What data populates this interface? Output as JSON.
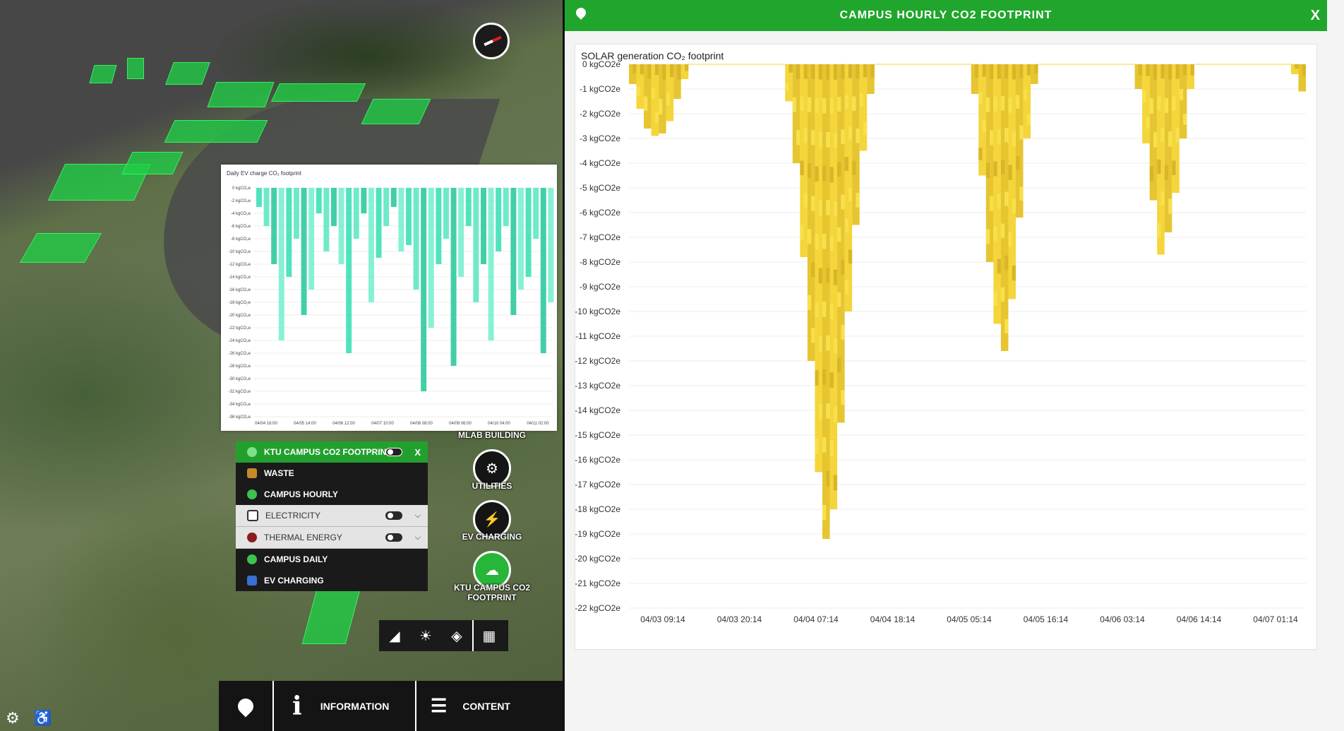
{
  "panel": {
    "header_title": "CAMPUS HOURLY CO2 FOOTPRINT",
    "close_label": "X",
    "chart_title": "SOLAR generation CO₂ footprint"
  },
  "mini_chart_title": "Daily EV charge CO₂ footprint",
  "layers": {
    "header": {
      "label": "KTU CAMPUS CO2 FOOTPRINT",
      "close": "X"
    },
    "items": [
      {
        "label": "WASTE",
        "style": "dark",
        "toggle": false
      },
      {
        "label": "CAMPUS HOURLY",
        "style": "dark",
        "toggle": false
      },
      {
        "label": "ELECTRICITY",
        "style": "light",
        "toggle": true
      },
      {
        "label": "THERMAL ENERGY",
        "style": "light",
        "toggle": true
      },
      {
        "label": "CAMPUS DAILY",
        "style": "dark",
        "toggle": false
      },
      {
        "label": "EV CHARGING",
        "style": "dark",
        "toggle": false
      }
    ]
  },
  "poi": {
    "mlab": "MLAB BUILDING",
    "utilities": "UTILITIES",
    "ev": "EV CHARGING",
    "ktu_line1": "KTU CAMPUS CO2",
    "ktu_line2": "FOOTPRINT"
  },
  "bottombar": {
    "information": "INFORMATION",
    "content": "CONTENT"
  },
  "colors": {
    "accent": "#20a62c",
    "solar": "#f4d53a",
    "solar_dark": "#d9b528",
    "ev": "#3ee0b6"
  },
  "chart_data": [
    {
      "type": "bar",
      "title": "SOLAR generation CO₂ footprint",
      "ylabel": "",
      "ylim": [
        -22,
        0
      ],
      "yticks": [
        "0 kgCO2e",
        "-1 kgCO2e",
        "-2 kgCO2e",
        "-3 kgCO2e",
        "-4 kgCO2e",
        "-5 kgCO2e",
        "-6 kgCO2e",
        "-7 kgCO2e",
        "-8 kgCO2e",
        "-9 kgCO2e",
        "-10 kgCO2e",
        "-11 kgCO2e",
        "-12 kgCO2e",
        "-13 kgCO2e",
        "-14 kgCO2e",
        "-15 kgCO2e",
        "-16 kgCO2e",
        "-17 kgCO2e",
        "-18 kgCO2e",
        "-19 kgCO2e",
        "-20 kgCO2e",
        "-21 kgCO2e",
        "-22 kgCO2e"
      ],
      "xticks": [
        "04/03 09:14",
        "04/03 20:14",
        "04/04 07:14",
        "04/04 18:14",
        "04/05 05:14",
        "04/05 16:14",
        "04/06 03:14",
        "04/06 14:14",
        "04/07 01:14"
      ],
      "x": [
        "04/03 09:14",
        "04/03 10:14",
        "04/03 11:14",
        "04/03 12:14",
        "04/03 13:14",
        "04/03 14:14",
        "04/03 15:14",
        "04/03 16:14",
        "04/03 17:14",
        "04/03 18:14",
        "04/03 19:14",
        "04/03 20:14",
        "04/03 21:14",
        "04/03 22:14",
        "04/03 23:14",
        "04/04 00:14",
        "04/04 01:14",
        "04/04 02:14",
        "04/04 03:14",
        "04/04 04:14",
        "04/04 05:14",
        "04/04 06:14",
        "04/04 07:14",
        "04/04 08:14",
        "04/04 09:14",
        "04/04 10:14",
        "04/04 11:14",
        "04/04 12:14",
        "04/04 13:14",
        "04/04 14:14",
        "04/04 15:14",
        "04/04 16:14",
        "04/04 17:14",
        "04/04 18:14",
        "04/04 19:14",
        "04/04 20:14",
        "04/04 21:14",
        "04/04 22:14",
        "04/04 23:14",
        "04/05 00:14",
        "04/05 01:14",
        "04/05 02:14",
        "04/05 03:14",
        "04/05 04:14",
        "04/05 05:14",
        "04/05 06:14",
        "04/05 07:14",
        "04/05 08:14",
        "04/05 09:14",
        "04/05 10:14",
        "04/05 11:14",
        "04/05 12:14",
        "04/05 13:14",
        "04/05 14:14",
        "04/05 15:14",
        "04/05 16:14",
        "04/05 17:14",
        "04/05 18:14",
        "04/05 19:14",
        "04/05 20:14",
        "04/05 21:14",
        "04/05 22:14",
        "04/05 23:14",
        "04/06 00:14",
        "04/06 01:14",
        "04/06 02:14",
        "04/06 03:14",
        "04/06 04:14",
        "04/06 05:14",
        "04/06 06:14",
        "04/06 07:14",
        "04/06 08:14",
        "04/06 09:14",
        "04/06 10:14",
        "04/06 11:14",
        "04/06 12:14",
        "04/06 13:14",
        "04/06 14:14",
        "04/06 15:14",
        "04/06 16:14",
        "04/06 17:14",
        "04/06 18:14",
        "04/06 19:14",
        "04/06 20:14",
        "04/06 21:14",
        "04/06 22:14",
        "04/06 23:14",
        "04/07 00:14",
        "04/07 01:14",
        "04/07 02:14",
        "04/07 03:14",
        "04/07 04:14",
        "04/07 05:14",
        "04/07 06:14",
        "04/07 07:14",
        "04/07 08:14"
      ],
      "values": [
        -0.8,
        -1.8,
        -2.6,
        -2.9,
        -2.8,
        -2.3,
        -1.4,
        -0.6,
        0,
        0,
        0,
        0,
        0,
        0,
        0,
        0,
        0,
        0,
        0,
        0,
        0,
        -1.5,
        -4.0,
        -7.8,
        -12.0,
        -16.5,
        -19.2,
        -18.0,
        -14.5,
        -10.0,
        -6.5,
        -3.5,
        -1.2,
        0,
        0,
        0,
        0,
        0,
        0,
        0,
        0,
        0,
        0,
        0,
        0,
        0,
        -1.2,
        -4.5,
        -8.0,
        -10.5,
        -11.6,
        -9.5,
        -6.2,
        -3.0,
        -0.8,
        0,
        0,
        0,
        0,
        0,
        0,
        0,
        0,
        0,
        0,
        0,
        0,
        0,
        -1.0,
        -3.2,
        -5.5,
        -7.7,
        -6.8,
        -5.2,
        -3.0,
        -1.0,
        0,
        0,
        0,
        0,
        0,
        0,
        0,
        0,
        0,
        0,
        0,
        0,
        0,
        -0.4,
        -1.1
      ]
    },
    {
      "type": "bar",
      "title": "Daily EV charge CO₂ footprint",
      "ylim": [
        -36,
        0
      ],
      "yticks": [
        "0 kgCO₂e",
        "-2 kgCO₂e",
        "-4 kgCO₂e",
        "-6 kgCO₂e",
        "-8 kgCO₂e",
        "-10 kgCO₂e",
        "-12 kgCO₂e",
        "-14 kgCO₂e",
        "-16 kgCO₂e",
        "-18 kgCO₂e",
        "-20 kgCO₂e",
        "-22 kgCO₂e",
        "-24 kgCO₂e",
        "-26 kgCO₂e",
        "-28 kgCO₂e",
        "-30 kgCO₂e",
        "-32 kgCO₂e",
        "-34 kgCO₂e",
        "-36 kgCO₂e"
      ],
      "xticks": [
        "04/04 16:00",
        "04/05 14:00",
        "04/06 12:00",
        "04/07 10:00",
        "04/08 08:00",
        "04/09 06:00",
        "04/10 04:00",
        "04/11 02:00"
      ],
      "values": [
        -3,
        -6,
        -12,
        -24,
        -14,
        -8,
        -20,
        -16,
        -4,
        -10,
        -6,
        -12,
        -26,
        -8,
        -4,
        -18,
        -11,
        -6,
        -3,
        -10,
        -9,
        -16,
        -32,
        -22,
        -12,
        -8,
        -28,
        -14,
        -6,
        -18,
        -12,
        -24,
        -10,
        -6,
        -20,
        -16,
        -14,
        -8,
        -26,
        -18
      ]
    }
  ]
}
